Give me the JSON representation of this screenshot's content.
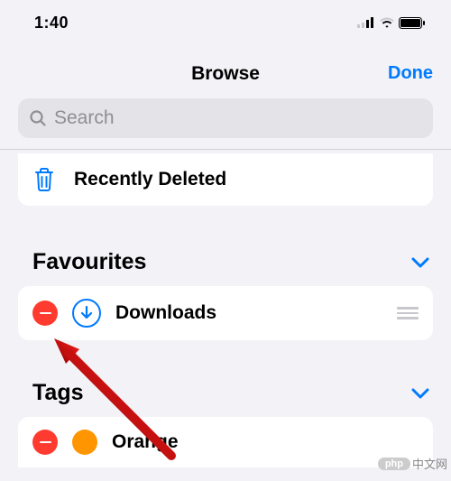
{
  "status": {
    "time": "1:40"
  },
  "nav": {
    "title": "Browse",
    "done": "Done"
  },
  "search": {
    "placeholder": "Search"
  },
  "locations": {
    "recently_deleted": "Recently Deleted"
  },
  "favourites": {
    "title": "Favourites",
    "items": [
      {
        "label": "Downloads"
      }
    ]
  },
  "tags": {
    "title": "Tags",
    "items": [
      {
        "label": "Orange",
        "color": "#ff9500"
      }
    ]
  },
  "watermark": {
    "pill": "php",
    "text": "中文网"
  }
}
